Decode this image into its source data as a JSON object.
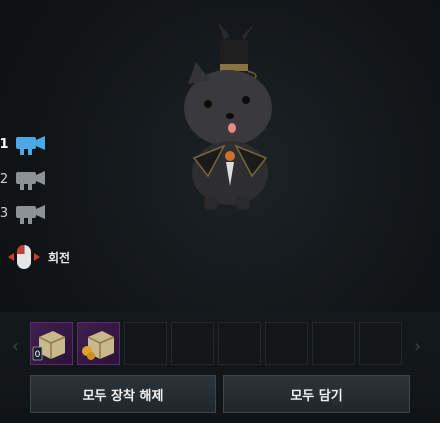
{
  "cameras": [
    {
      "number": "1",
      "active": true
    },
    {
      "number": "2",
      "active": false
    },
    {
      "number": "3",
      "active": false
    }
  ],
  "rotate_label": "회전",
  "buttons": {
    "unequip_all": "모두 장착 해제",
    "add_all": "모두 담기"
  },
  "slots": [
    {
      "filled": true,
      "item": "gift-box-icon",
      "badge": "0"
    },
    {
      "filled": true,
      "item": "gift-box-icon"
    },
    {
      "filled": false
    },
    {
      "filled": false
    },
    {
      "filled": false
    },
    {
      "filled": false
    },
    {
      "filled": false
    },
    {
      "filled": false
    }
  ],
  "colors": {
    "active_camera": "#4aa8e6",
    "inactive_camera": "#8c9296",
    "filled_slot": "#3f1f4f"
  }
}
